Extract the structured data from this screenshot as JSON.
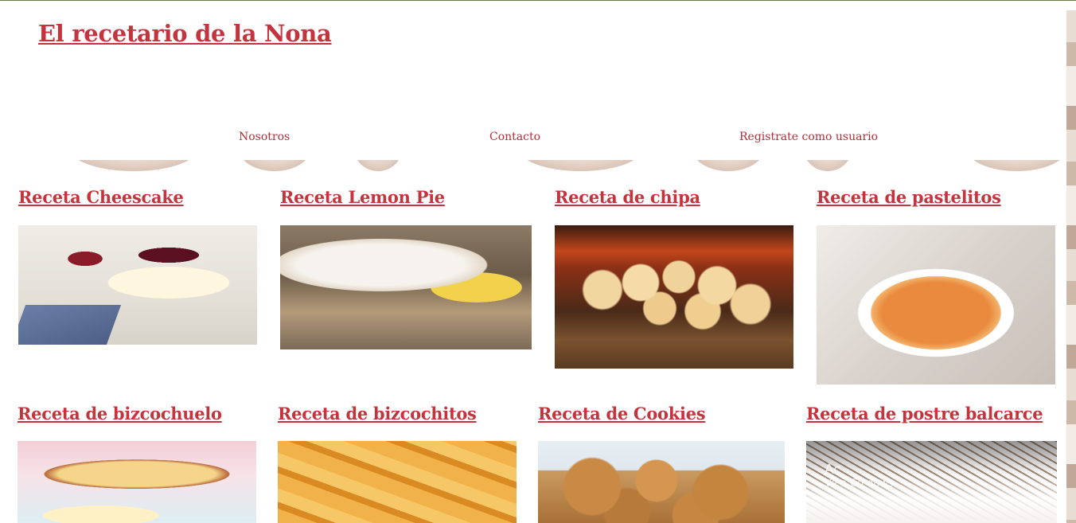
{
  "site": {
    "title": "El recetario de la Nona"
  },
  "nav": {
    "items": [
      {
        "label": "Nosotros"
      },
      {
        "label": "Contacto"
      },
      {
        "label": "Registrate como usuario"
      }
    ]
  },
  "recipes": [
    {
      "title": "Receta Cheescake",
      "image": "cheesecake-photo"
    },
    {
      "title": "Receta Lemon Pie",
      "image": "lemon-pie-photo"
    },
    {
      "title": "Receta de chipa",
      "image": "chipa-photo"
    },
    {
      "title": "Receta de pastelitos",
      "image": "pastelitos-photo"
    },
    {
      "title": "Receta de bizcochuelo",
      "image": "bizcochuelo-photo"
    },
    {
      "title": "Receta de bizcochitos",
      "image": "bizcochitos-photo"
    },
    {
      "title": "Receta de Cookies",
      "image": "cookies-photo"
    },
    {
      "title": "Receta de postre balcarce",
      "image": "postre-balcarce-photo"
    }
  ],
  "os_watermark": {
    "line1": "Ac",
    "line2": "Ve a Co                                    dows."
  },
  "colors": {
    "accent": "#c4343f",
    "nav_link": "#b0303a",
    "top_border": "#6b7a4a"
  }
}
